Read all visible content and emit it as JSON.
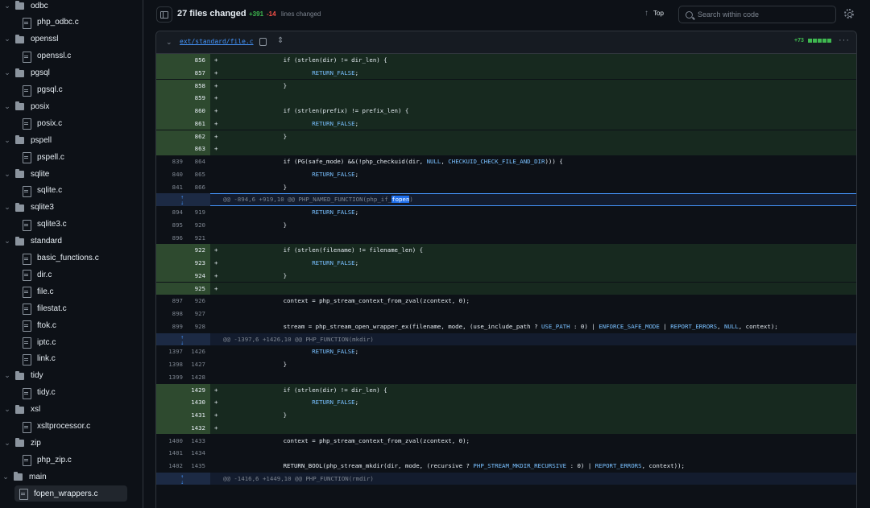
{
  "sidebar": {
    "items": [
      {
        "type": "folder",
        "label": "odbc",
        "depth": 0
      },
      {
        "type": "file",
        "label": "php_odbc.c",
        "depth": 1
      },
      {
        "type": "folder",
        "label": "openssl",
        "depth": 0
      },
      {
        "type": "file",
        "label": "openssl.c",
        "depth": 1
      },
      {
        "type": "folder",
        "label": "pgsql",
        "depth": 0
      },
      {
        "type": "file",
        "label": "pgsql.c",
        "depth": 1
      },
      {
        "type": "folder",
        "label": "posix",
        "depth": 0
      },
      {
        "type": "file",
        "label": "posix.c",
        "depth": 1
      },
      {
        "type": "folder",
        "label": "pspell",
        "depth": 0
      },
      {
        "type": "file",
        "label": "pspell.c",
        "depth": 1
      },
      {
        "type": "folder",
        "label": "sqlite",
        "depth": 0
      },
      {
        "type": "file",
        "label": "sqlite.c",
        "depth": 1
      },
      {
        "type": "folder",
        "label": "sqlite3",
        "depth": 0
      },
      {
        "type": "file",
        "label": "sqlite3.c",
        "depth": 1
      },
      {
        "type": "folder",
        "label": "standard",
        "depth": 0
      },
      {
        "type": "file",
        "label": "basic_functions.c",
        "depth": 1
      },
      {
        "type": "file",
        "label": "dir.c",
        "depth": 1
      },
      {
        "type": "file",
        "label": "file.c",
        "depth": 1
      },
      {
        "type": "file",
        "label": "filestat.c",
        "depth": 1
      },
      {
        "type": "file",
        "label": "ftok.c",
        "depth": 1
      },
      {
        "type": "file",
        "label": "iptc.c",
        "depth": 1
      },
      {
        "type": "file",
        "label": "link.c",
        "depth": 1
      },
      {
        "type": "folder",
        "label": "tidy",
        "depth": 0
      },
      {
        "type": "file",
        "label": "tidy.c",
        "depth": 1
      },
      {
        "type": "folder",
        "label": "xsl",
        "depth": 0
      },
      {
        "type": "file",
        "label": "xsltprocessor.c",
        "depth": 1
      },
      {
        "type": "folder",
        "label": "zip",
        "depth": 0
      },
      {
        "type": "file",
        "label": "php_zip.c",
        "depth": 1
      },
      {
        "type": "folder",
        "label": "main",
        "depth": -1
      },
      {
        "type": "file",
        "label": "fopen_wrappers.c",
        "depth": 0,
        "active": true
      }
    ]
  },
  "toolbar": {
    "files_changed": "27 files changed",
    "additions": "+391",
    "deletions": "-14",
    "lines_changed": "lines changed",
    "top_label": "Top",
    "search_placeholder": "Search within code"
  },
  "diff": {
    "file_path": "ext/standard/file.c",
    "stat_label": "+73",
    "lines": [
      {
        "kind": "add",
        "old": "",
        "new": "856",
        "sign": "+",
        "code": "        if (strlen(dir) != dir_len) {"
      },
      {
        "kind": "add",
        "old": "",
        "new": "857",
        "sign": "+",
        "code": "                RETURN_FALSE;"
      },
      {
        "kind": "add",
        "old": "",
        "new": "858",
        "sign": "+",
        "code": "        }"
      },
      {
        "kind": "add",
        "old": "",
        "new": "859",
        "sign": "+",
        "code": ""
      },
      {
        "kind": "add",
        "old": "",
        "new": "860",
        "sign": "+",
        "code": "        if (strlen(prefix) != prefix_len) {"
      },
      {
        "kind": "add",
        "old": "",
        "new": "861",
        "sign": "+",
        "code": "                RETURN_FALSE;"
      },
      {
        "kind": "add",
        "old": "",
        "new": "862",
        "sign": "+",
        "code": "        }"
      },
      {
        "kind": "add",
        "old": "",
        "new": "863",
        "sign": "+",
        "code": ""
      },
      {
        "kind": "ctx",
        "old": "839",
        "new": "864",
        "sign": "",
        "code": "        if (PG(safe_mode) &&(!php_checkuid(dir, NULL, CHECKUID_CHECK_FILE_AND_DIR))) {"
      },
      {
        "kind": "ctx",
        "old": "840",
        "new": "865",
        "sign": "",
        "code": "                RETURN_FALSE;"
      },
      {
        "kind": "ctx",
        "old": "841",
        "new": "866",
        "sign": "",
        "code": "        }"
      },
      {
        "kind": "hunk",
        "selected": true,
        "code": "@@ -894,6 +919,10 @@ PHP_NAMED_FUNCTION(php_if_",
        "highlight": "fopen",
        "after": ")"
      },
      {
        "kind": "ctx",
        "old": "894",
        "new": "919",
        "sign": "",
        "code": "                RETURN_FALSE;"
      },
      {
        "kind": "ctx",
        "old": "895",
        "new": "920",
        "sign": "",
        "code": "        }"
      },
      {
        "kind": "ctx",
        "old": "896",
        "new": "921",
        "sign": "",
        "code": ""
      },
      {
        "kind": "add",
        "old": "",
        "new": "922",
        "sign": "+",
        "code": "        if (strlen(filename) != filename_len) {"
      },
      {
        "kind": "add",
        "old": "",
        "new": "923",
        "sign": "+",
        "code": "                RETURN_FALSE;"
      },
      {
        "kind": "add",
        "old": "",
        "new": "924",
        "sign": "+",
        "code": "        }"
      },
      {
        "kind": "add",
        "old": "",
        "new": "925",
        "sign": "+",
        "code": ""
      },
      {
        "kind": "ctx",
        "old": "897",
        "new": "926",
        "sign": "",
        "code": "        context = php_stream_context_from_zval(zcontext, 0);"
      },
      {
        "kind": "ctx",
        "old": "898",
        "new": "927",
        "sign": "",
        "code": ""
      },
      {
        "kind": "ctx",
        "old": "899",
        "new": "928",
        "sign": "",
        "code": "        stream = php_stream_open_wrapper_ex(filename, mode, (use_include_path ? USE_PATH : 0) | ENFORCE_SAFE_MODE | REPORT_ERRORS, NULL, context);"
      },
      {
        "kind": "hunk",
        "selected": false,
        "code": "@@ -1397,6 +1426,10 @@ PHP_FUNCTION(mkdir)",
        "highlight": "",
        "after": ""
      },
      {
        "kind": "ctx",
        "old": "1397",
        "new": "1426",
        "sign": "",
        "code": "                RETURN_FALSE;"
      },
      {
        "kind": "ctx",
        "old": "1398",
        "new": "1427",
        "sign": "",
        "code": "        }"
      },
      {
        "kind": "ctx",
        "old": "1399",
        "new": "1428",
        "sign": "",
        "code": ""
      },
      {
        "kind": "add",
        "old": "",
        "new": "1429",
        "sign": "+",
        "code": "        if (strlen(dir) != dir_len) {"
      },
      {
        "kind": "add",
        "old": "",
        "new": "1430",
        "sign": "+",
        "code": "                RETURN_FALSE;"
      },
      {
        "kind": "add",
        "old": "",
        "new": "1431",
        "sign": "+",
        "code": "        }"
      },
      {
        "kind": "add",
        "old": "",
        "new": "1432",
        "sign": "+",
        "code": ""
      },
      {
        "kind": "ctx",
        "old": "1400",
        "new": "1433",
        "sign": "",
        "code": "        context = php_stream_context_from_zval(zcontext, 0);"
      },
      {
        "kind": "ctx",
        "old": "1401",
        "new": "1434",
        "sign": "",
        "code": ""
      },
      {
        "kind": "ctx",
        "old": "1402",
        "new": "1435",
        "sign": "",
        "code": "        RETURN_BOOL(php_stream_mkdir(dir, mode, (recursive ? PHP_STREAM_MKDIR_RECURSIVE : 0) | REPORT_ERRORS, context));"
      },
      {
        "kind": "hunk",
        "selected": false,
        "code": "@@ -1416,6 +1449,10 @@ PHP_FUNCTION(rmdir)",
        "highlight": "",
        "after": ""
      }
    ]
  },
  "colors": {
    "background": "#0d1117",
    "add_bg": "#17291f",
    "add_gutter": "#2e4a2f",
    "accent": "#4493f8",
    "addition": "#3fb950",
    "deletion": "#f85149"
  }
}
